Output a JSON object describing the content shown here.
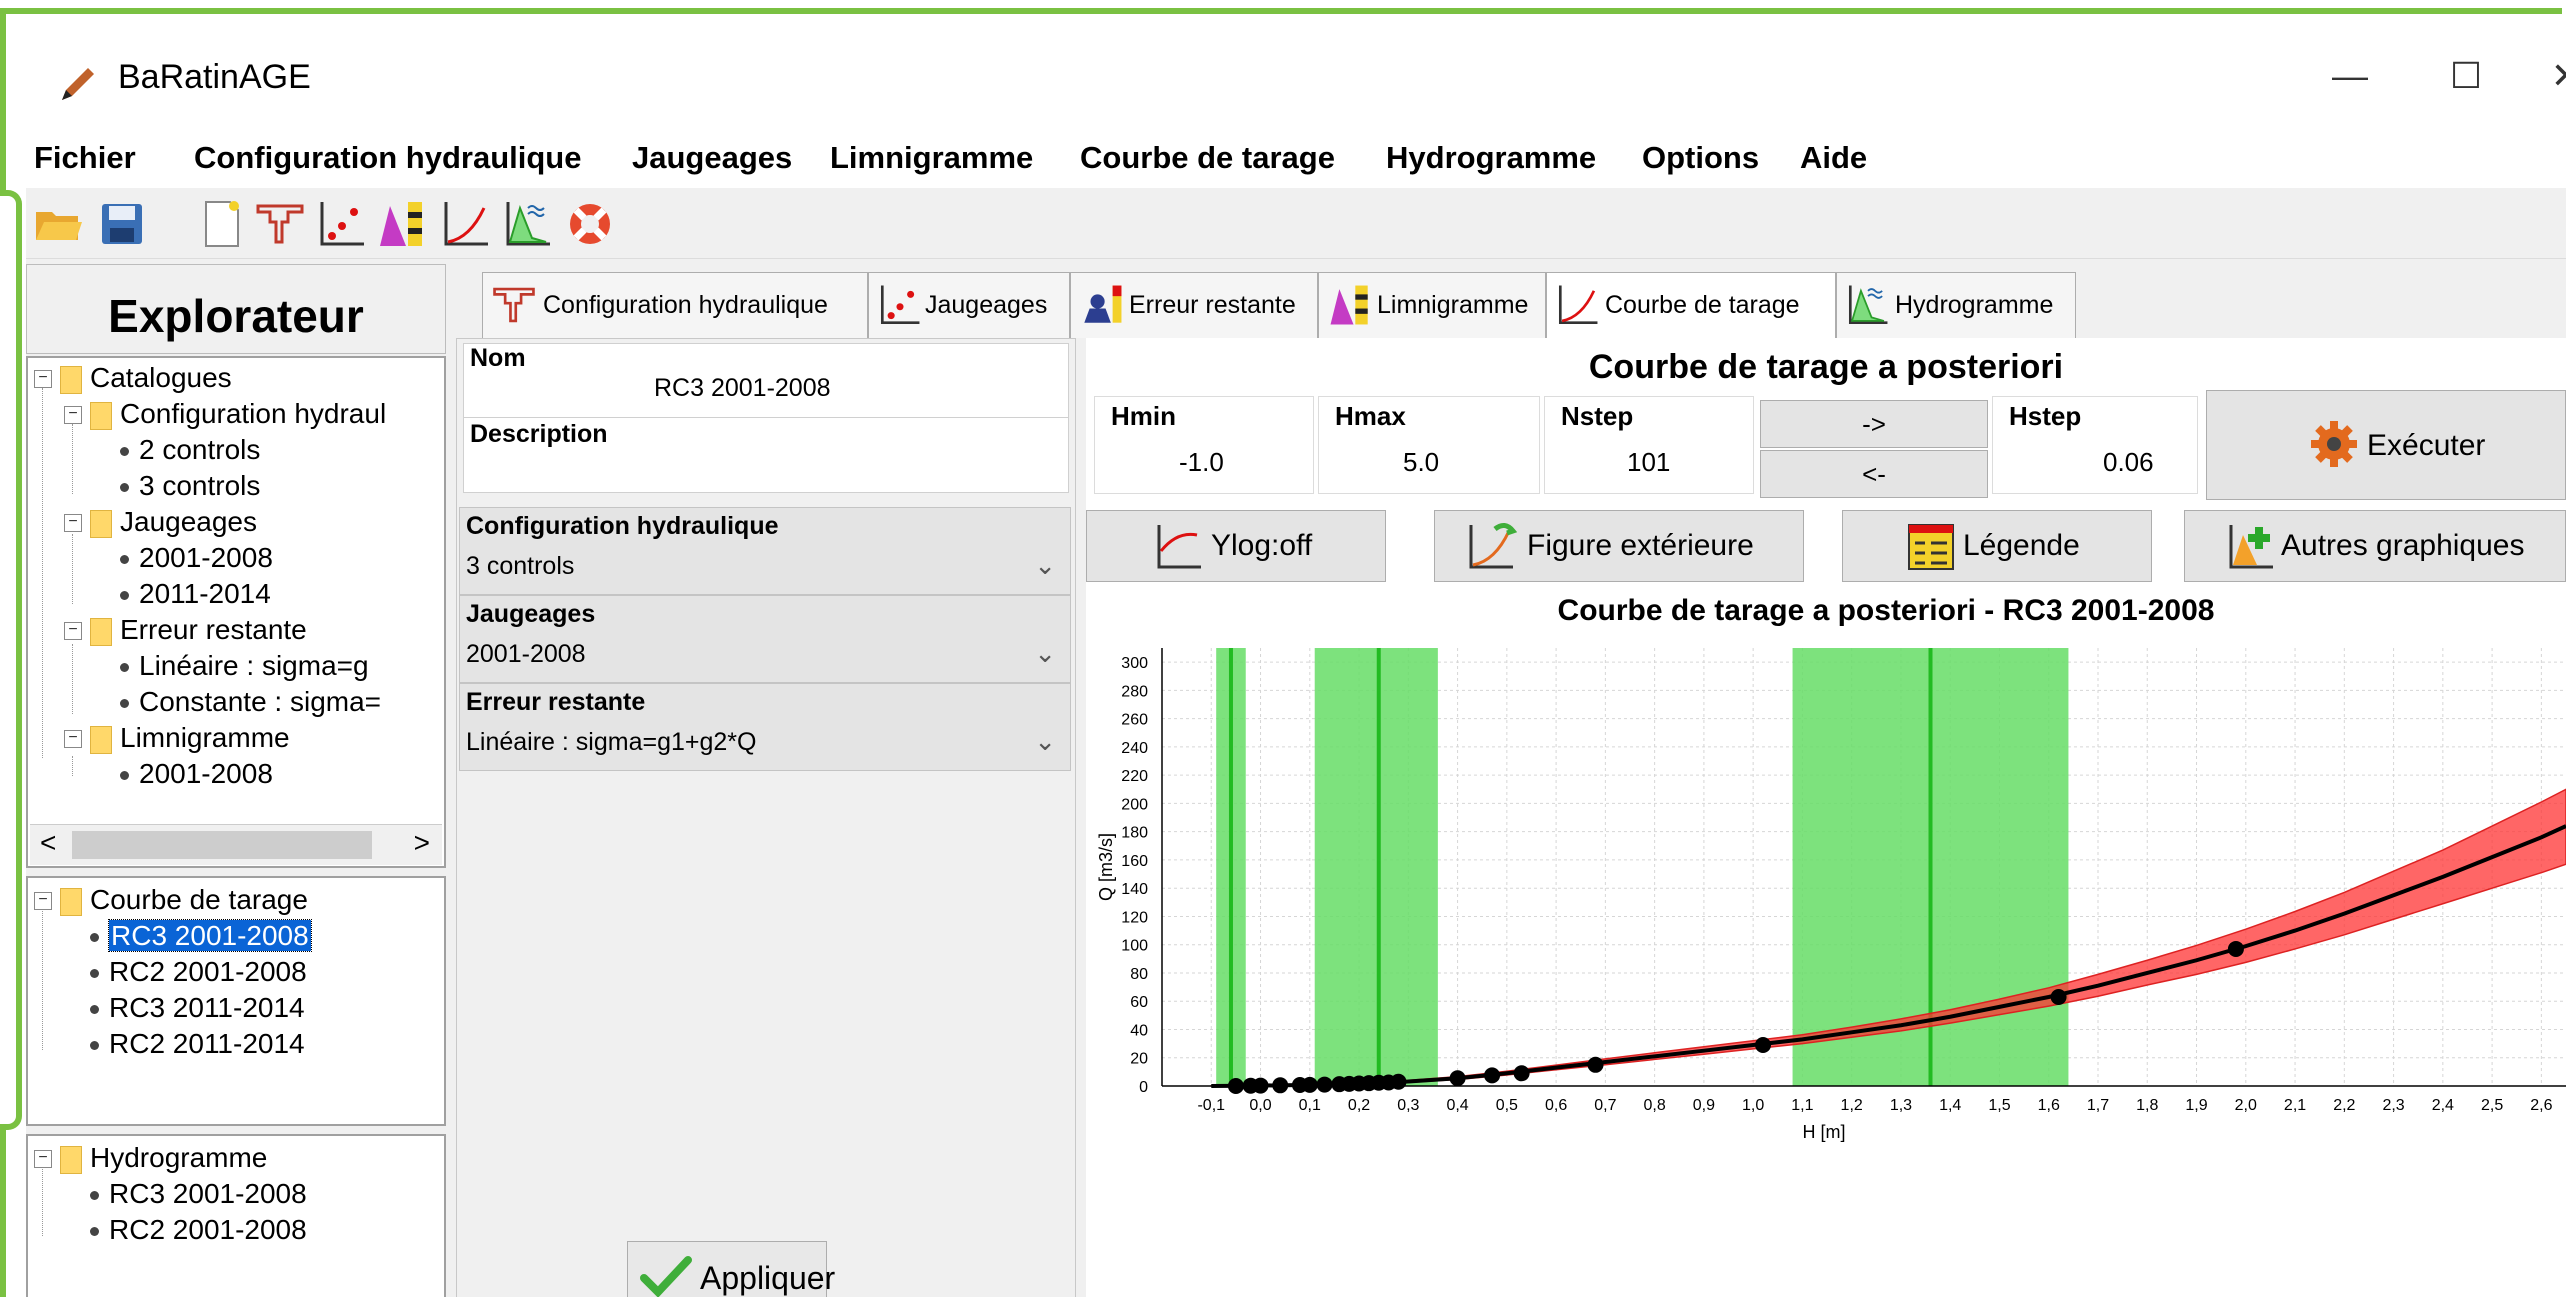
{
  "window": {
    "title": "BaRatinAGE",
    "controls": [
      "—",
      "☐",
      "✕"
    ]
  },
  "menubar": [
    "Fichier",
    "Configuration hydraulique",
    "Jaugeages",
    "Limnigramme",
    "Courbe de tarage",
    "Hydrogramme",
    "Options",
    "Aide"
  ],
  "toolbar": [
    "open-folder-icon",
    "save-icon",
    "new-document-icon",
    "hydraulic-config-icon",
    "gaugings-icon",
    "remnant-error-icon",
    "limnigraph-icon",
    "rating-curve-icon",
    "hydrograph-icon",
    "help-lifebuoy-icon"
  ],
  "explorer": {
    "title": "Explorateur",
    "catalog": {
      "root": "Catalogues",
      "items": [
        {
          "label": "Configuration hydraul",
          "level": 1
        },
        {
          "label": "2 controls",
          "level": 2
        },
        {
          "label": "3 controls",
          "level": 2
        },
        {
          "label": "Jaugeages",
          "level": 1
        },
        {
          "label": "2001-2008",
          "level": 2
        },
        {
          "label": "2011-2014",
          "level": 2
        },
        {
          "label": "Erreur restante",
          "level": 1
        },
        {
          "label": "Linéaire : sigma=g",
          "level": 2
        },
        {
          "label": "Constante : sigma=",
          "level": 2
        },
        {
          "label": "Limnigramme",
          "level": 1
        },
        {
          "label": "2001-2008",
          "level": 2
        }
      ]
    },
    "ratings": {
      "root": "Courbe de tarage",
      "items": [
        "RC3 2001-2008",
        "RC2 2001-2008",
        "RC3 2011-2014",
        "RC2 2011-2014"
      ],
      "selected": 0
    },
    "hydrographs": {
      "root": "Hydrogramme",
      "items": [
        "RC3 2001-2008",
        "RC2 2001-2008"
      ]
    },
    "scroll_left": "<",
    "scroll_right": ">"
  },
  "tabs": [
    {
      "label": "Configuration hydraulique",
      "icon": "hydraulic-config-icon"
    },
    {
      "label": "Jaugeages",
      "icon": "gaugings-icon"
    },
    {
      "label": "Erreur restante",
      "icon": "remnant-error-icon"
    },
    {
      "label": "Limnigramme",
      "icon": "limnigraph-icon"
    },
    {
      "label": "Courbe de tarage",
      "icon": "rating-curve-icon",
      "active": true
    },
    {
      "label": "Hydrogramme",
      "icon": "hydrograph-icon"
    }
  ],
  "form": {
    "nom_label": "Nom",
    "nom_value": "RC3 2001-2008",
    "description_label": "Description",
    "description_value": "",
    "config_label": "Configuration hydraulique",
    "config_value": "3 controls",
    "jaugeages_label": "Jaugeages",
    "jaugeages_value": "2001-2008",
    "erreur_label": "Erreur restante",
    "erreur_value": "Linéaire : sigma=g1+g2*Q",
    "apply_label": "Appliquer"
  },
  "posterior": {
    "title": "Courbe de tarage a posteriori",
    "hmin_label": "Hmin",
    "hmin_value": "-1.0",
    "hmax_label": "Hmax",
    "hmax_value": "5.0",
    "nstep_label": "Nstep",
    "nstep_value": "101",
    "hstep_label": "Hstep",
    "hstep_value": "0.06",
    "arrow_right": "->",
    "arrow_left": "<-",
    "execute_label": "Exécuter"
  },
  "graph_buttons": {
    "ylog": "Ylog:off",
    "figure": "Figure extérieure",
    "legend": "Légende",
    "other": "Autres graphiques"
  },
  "chart_data": {
    "type": "line",
    "title": "Courbe de tarage a posteriori - RC3 2001-2008",
    "xlabel": "H [m]",
    "ylabel": "Q [m3/s]",
    "xlim": [
      -0.2,
      2.65
    ],
    "ylim": [
      0,
      310
    ],
    "xticks": [
      "-0,1",
      "0,0",
      "0,1",
      "0,2",
      "0,3",
      "0,4",
      "0,5",
      "0,6",
      "0,7",
      "0,8",
      "0,9",
      "1,0",
      "1,1",
      "1,2",
      "1,3",
      "1,4",
      "1,5",
      "1,6",
      "1,7",
      "1,8",
      "1,9",
      "2,0",
      "2,1",
      "2,2",
      "2,3",
      "2,4",
      "2,5",
      "2,6"
    ],
    "yticks": [
      "0",
      "20",
      "40",
      "60",
      "80",
      "100",
      "120",
      "140",
      "160",
      "180",
      "200",
      "220",
      "240",
      "260",
      "280",
      "300"
    ],
    "grid": true,
    "colors": {
      "activation_band": "#66dd66",
      "activation_line": "#22bb22",
      "uncertainty": "#ff3333",
      "curve": "#000000",
      "points": "#000000"
    },
    "activation_bands": [
      {
        "center": -0.06,
        "lo": -0.09,
        "hi": -0.03
      },
      {
        "center": 0.24,
        "lo": 0.11,
        "hi": 0.36
      },
      {
        "center": 1.36,
        "lo": 1.08,
        "hi": 1.64
      }
    ],
    "curve": {
      "x": [
        -0.1,
        0.0,
        0.1,
        0.2,
        0.3,
        0.4,
        0.5,
        0.6,
        0.7,
        0.8,
        0.9,
        1.0,
        1.1,
        1.2,
        1.3,
        1.4,
        1.5,
        1.6,
        1.7,
        1.8,
        1.9,
        2.0,
        2.1,
        2.2,
        2.3,
        2.4,
        2.5,
        2.6,
        2.65
      ],
      "y": [
        0,
        0.3,
        0.8,
        1.8,
        3.2,
        5.5,
        9,
        13,
        17,
        21,
        25,
        29,
        33,
        38,
        43,
        49,
        56,
        63,
        71,
        80,
        89,
        99,
        110,
        122,
        135,
        148,
        162,
        176,
        184
      ],
      "lower": [
        0,
        0.2,
        0.6,
        1.4,
        2.6,
        4.6,
        7.8,
        11.5,
        15,
        18.8,
        22.5,
        26.3,
        30,
        34.5,
        39,
        44.5,
        50.5,
        56.5,
        63.5,
        71.5,
        79,
        87.5,
        97,
        107,
        118,
        129,
        140,
        151,
        157
      ],
      "upper": [
        0.1,
        0.5,
        1.1,
        2.3,
        4,
        6.6,
        10.4,
        14.8,
        19.2,
        23.5,
        27.8,
        32,
        36.3,
        41.7,
        47.5,
        54,
        61.5,
        69.5,
        79,
        89,
        99.5,
        111,
        123.5,
        137,
        152,
        167,
        184,
        201,
        210
      ]
    },
    "gaugings": {
      "x": [
        -0.05,
        -0.02,
        0.0,
        0.04,
        0.08,
        0.1,
        0.13,
        0.16,
        0.18,
        0.2,
        0.22,
        0.24,
        0.26,
        0.28,
        0.4,
        0.47,
        0.53,
        0.68,
        1.02,
        1.62,
        1.98
      ],
      "y": [
        0,
        0.2,
        0.3,
        0.5,
        0.7,
        0.8,
        1.0,
        1.3,
        1.5,
        1.8,
        2.0,
        2.3,
        2.5,
        3.0,
        5.5,
        7.5,
        9,
        15,
        29,
        63,
        97
      ]
    }
  }
}
